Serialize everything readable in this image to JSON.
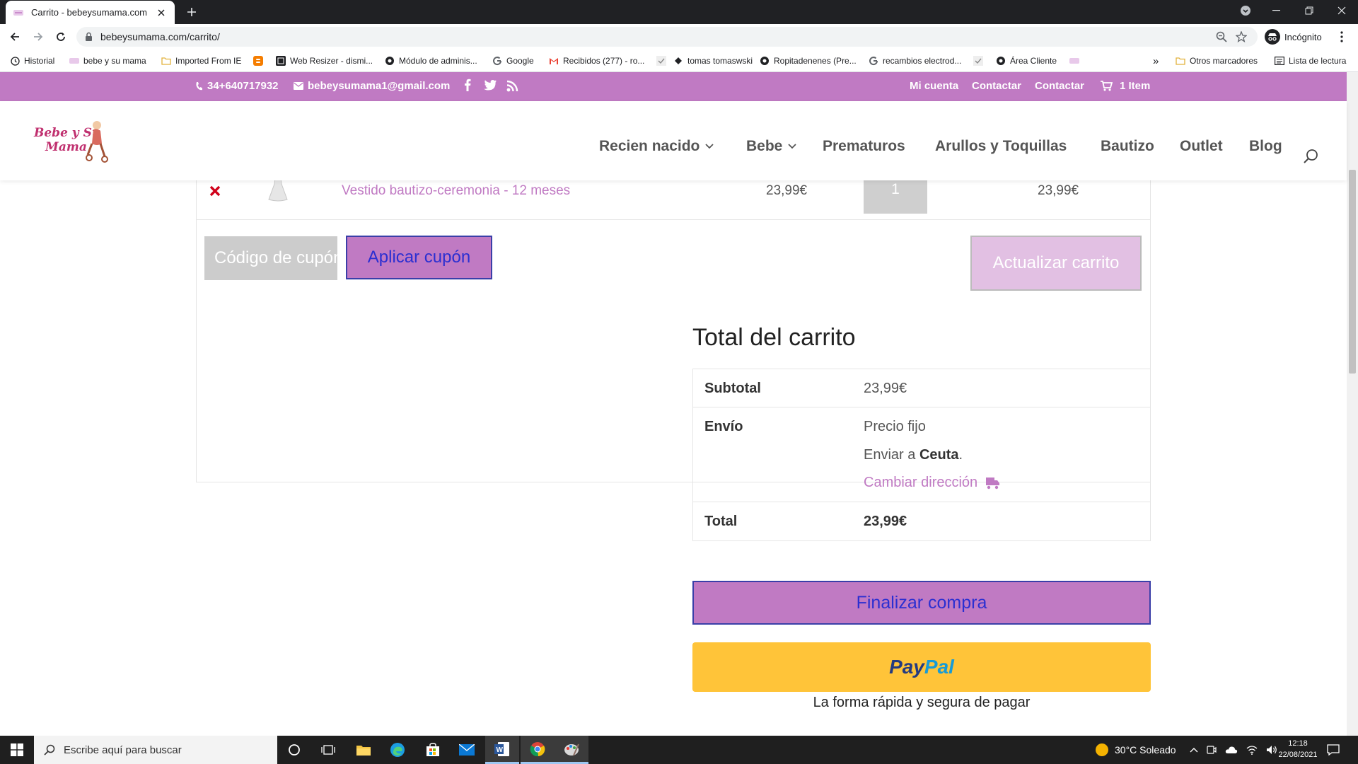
{
  "browser": {
    "tab_title": "Carrito - bebeysumama.com",
    "url": "bebeysumama.com/carrito/",
    "profile_label": "Incógnito",
    "bookmarks": [
      "Historial",
      "bebe y su mama",
      "Imported From IE",
      "",
      "Web Resizer - dismi...",
      "Módulo de adminis...",
      "Google",
      "Recibidos (277) - ro...",
      "",
      "tomas tomaswski",
      "Ropitadenenes (Pre...",
      "recambios electrod...",
      "",
      "Área Cliente",
      ""
    ],
    "bookmarks_more": "»",
    "other_bookmarks": "Otros marcadores",
    "reading_list": "Lista de lectura"
  },
  "site": {
    "brand_color": "#c07ac3",
    "topbar": {
      "phone": "34+640717932",
      "email": "bebeysumama1@gmail.com",
      "links": [
        "Mi cuenta",
        "Contactar",
        "Contactar"
      ],
      "cart": "1 Item"
    },
    "logo": {
      "line1": "Bebe y Su",
      "line2": "Mama"
    },
    "nav": [
      "Recien nacido",
      "Bebe",
      "Prematuros",
      "Arullos y Toquillas",
      "Bautizo",
      "Outlet",
      "Blog"
    ]
  },
  "cart": {
    "item": {
      "name": "Vestido bautizo-ceremonia - 12 meses",
      "price": "23,99€",
      "quantity": "1",
      "subtotal": "23,99€"
    },
    "coupon_placeholder": "Código de cupón",
    "apply_coupon": "Aplicar cupón",
    "update_cart": "Actualizar carrito"
  },
  "totals": {
    "title": "Total del carrito",
    "subtotal_label": "Subtotal",
    "subtotal_value": "23,99€",
    "shipping_label": "Envío",
    "shipping_method": "Precio fijo",
    "ship_to_prefix": "Enviar a",
    "ship_to_place": "Ceuta",
    "ship_to_suffix": ".",
    "change_address": "Cambiar dirección",
    "total_label": "Total",
    "total_value": "23,99€",
    "checkout": "Finalizar compra",
    "paypal_pay": "Pay",
    "paypal_pal": "Pal",
    "paypal_tagline": "La forma rápida y segura de pagar"
  },
  "taskbar": {
    "search_placeholder": "Escribe aquí para buscar",
    "weather": "30°C  Soleado",
    "time": "12:18",
    "date": "22/08/2021"
  }
}
